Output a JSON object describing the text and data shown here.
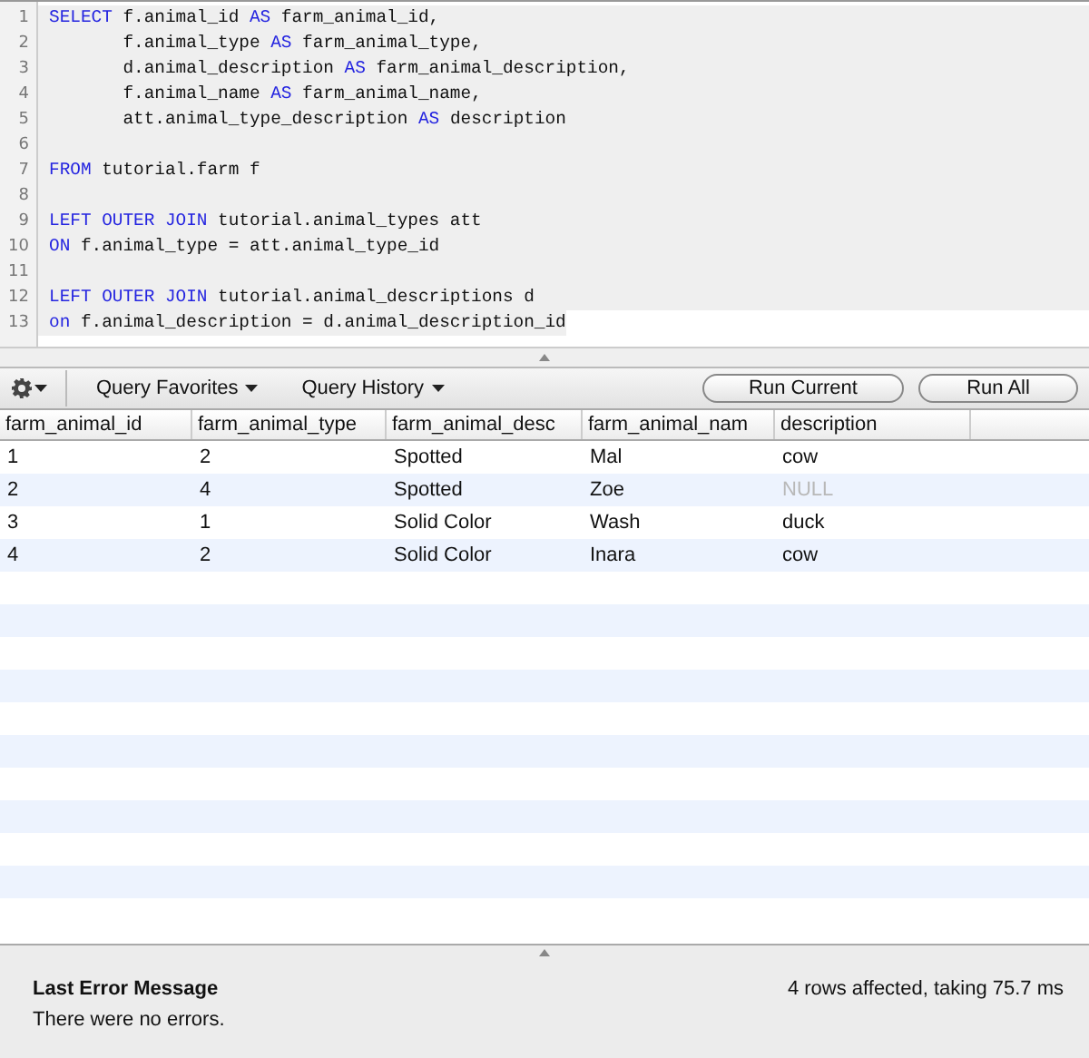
{
  "editor": {
    "lines": [
      {
        "number": "1",
        "selected": true,
        "tokens": [
          {
            "kind": "keyword",
            "text": "SELECT"
          },
          {
            "kind": "plain",
            "text": " f.animal_id "
          },
          {
            "kind": "keyword",
            "text": "AS"
          },
          {
            "kind": "plain",
            "text": " farm_animal_id,"
          }
        ]
      },
      {
        "number": "2",
        "selected": true,
        "tokens": [
          {
            "kind": "plain",
            "text": "       f.animal_type "
          },
          {
            "kind": "keyword",
            "text": "AS"
          },
          {
            "kind": "plain",
            "text": " farm_animal_type,"
          }
        ]
      },
      {
        "number": "3",
        "selected": true,
        "tokens": [
          {
            "kind": "plain",
            "text": "       d.animal_description "
          },
          {
            "kind": "keyword",
            "text": "AS"
          },
          {
            "kind": "plain",
            "text": " farm_animal_description,"
          }
        ]
      },
      {
        "number": "4",
        "selected": true,
        "tokens": [
          {
            "kind": "plain",
            "text": "       f.animal_name "
          },
          {
            "kind": "keyword",
            "text": "AS"
          },
          {
            "kind": "plain",
            "text": " farm_animal_name,"
          }
        ]
      },
      {
        "number": "5",
        "selected": true,
        "tokens": [
          {
            "kind": "plain",
            "text": "       att.animal_type_description "
          },
          {
            "kind": "keyword",
            "text": "AS"
          },
          {
            "kind": "plain",
            "text": " description"
          }
        ]
      },
      {
        "number": "6",
        "selected": true
      },
      {
        "number": "7",
        "selected": true,
        "tokens": [
          {
            "kind": "keyword",
            "text": "FROM"
          },
          {
            "kind": "plain",
            "text": " tutorial.farm f"
          }
        ]
      },
      {
        "number": "8",
        "selected": true
      },
      {
        "number": "9",
        "selected": true,
        "tokens": [
          {
            "kind": "keyword",
            "text": "LEFT OUTER JOIN"
          },
          {
            "kind": "plain",
            "text": " tutorial.animal_types att"
          }
        ]
      },
      {
        "number": "10",
        "selected": true,
        "tokens": [
          {
            "kind": "keyword",
            "text": "ON"
          },
          {
            "kind": "plain",
            "text": " f.animal_type = att.animal_type_id"
          }
        ]
      },
      {
        "number": "11",
        "selected": true
      },
      {
        "number": "12",
        "selected": true,
        "tokens": [
          {
            "kind": "keyword",
            "text": "LEFT OUTER JOIN"
          },
          {
            "kind": "plain",
            "text": " tutorial.animal_descriptions d"
          }
        ]
      },
      {
        "number": "13",
        "selected": true,
        "tokens": [
          {
            "kind": "keyword",
            "text": "on"
          },
          {
            "kind": "plain",
            "text": " f.animal_description = d.animal_description_id"
          }
        ]
      }
    ]
  },
  "toolbar": {
    "menus": [
      "Query Favorites",
      "Query History"
    ],
    "buttons": [
      "Run Current",
      "Run All"
    ]
  },
  "table": {
    "columns": [
      "farm_animal_id",
      "farm_animal_type",
      "farm_animal_desc",
      "farm_animal_nam",
      "description"
    ],
    "rows": [
      [
        {
          "text": "1",
          "null": false
        },
        {
          "text": "2",
          "null": false
        },
        {
          "text": "Spotted",
          "null": false
        },
        {
          "text": "Mal",
          "null": false
        },
        {
          "text": "cow",
          "null": false
        }
      ],
      [
        {
          "text": "2",
          "null": false
        },
        {
          "text": "4",
          "null": false
        },
        {
          "text": "Spotted",
          "null": false
        },
        {
          "text": "Zoe",
          "null": false
        },
        {
          "text": "NULL",
          "null": true
        }
      ],
      [
        {
          "text": "3",
          "null": false
        },
        {
          "text": "1",
          "null": false
        },
        {
          "text": "Solid Color",
          "null": false
        },
        {
          "text": "Wash",
          "null": false
        },
        {
          "text": "duck",
          "null": false
        }
      ],
      [
        {
          "text": "4",
          "null": false
        },
        {
          "text": "2",
          "null": false
        },
        {
          "text": "Solid Color",
          "null": false
        },
        {
          "text": "Inara",
          "null": false
        },
        {
          "text": "cow",
          "null": false
        }
      ]
    ]
  },
  "status": {
    "title": "Last Error Message",
    "message": "There were no errors.",
    "summary": "4 rows affected, taking 75.7 ms"
  }
}
